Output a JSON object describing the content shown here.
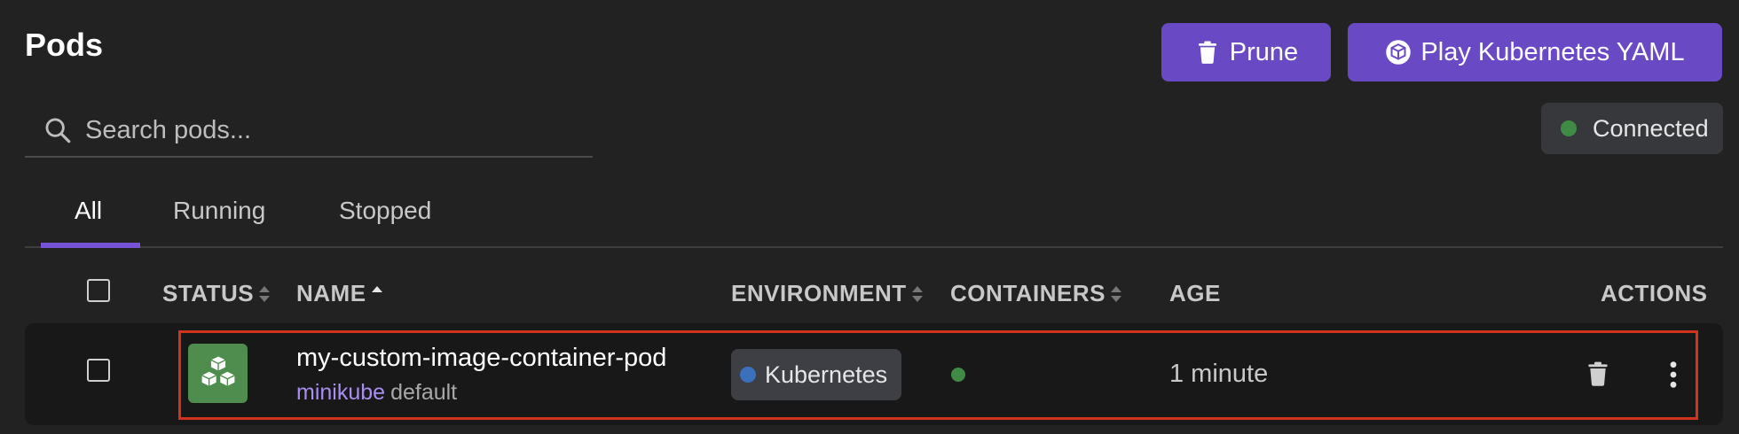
{
  "page": {
    "title": "Pods"
  },
  "toolbar": {
    "prune_label": "Prune",
    "play_yaml_label": "Play Kubernetes YAML"
  },
  "search": {
    "placeholder": "Search pods..."
  },
  "status": {
    "connection_label": "Connected"
  },
  "tabs": [
    {
      "label": "All"
    },
    {
      "label": "Running"
    },
    {
      "label": "Stopped"
    }
  ],
  "table": {
    "headers": {
      "status": "STATUS",
      "name": "NAME",
      "environment": "ENVIRONMENT",
      "containers": "CONTAINERS",
      "age": "AGE",
      "actions": "ACTIONS"
    },
    "rows": [
      {
        "name": "my-custom-image-container-pod",
        "context": "minikube",
        "namespace": "default",
        "environment": "Kubernetes",
        "age": "1 minute"
      }
    ]
  },
  "colors": {
    "accent": "#6a49c5",
    "connected": "#3f8b45",
    "env_kubernetes": "#3b70bd",
    "highlight": "#d0341f"
  }
}
